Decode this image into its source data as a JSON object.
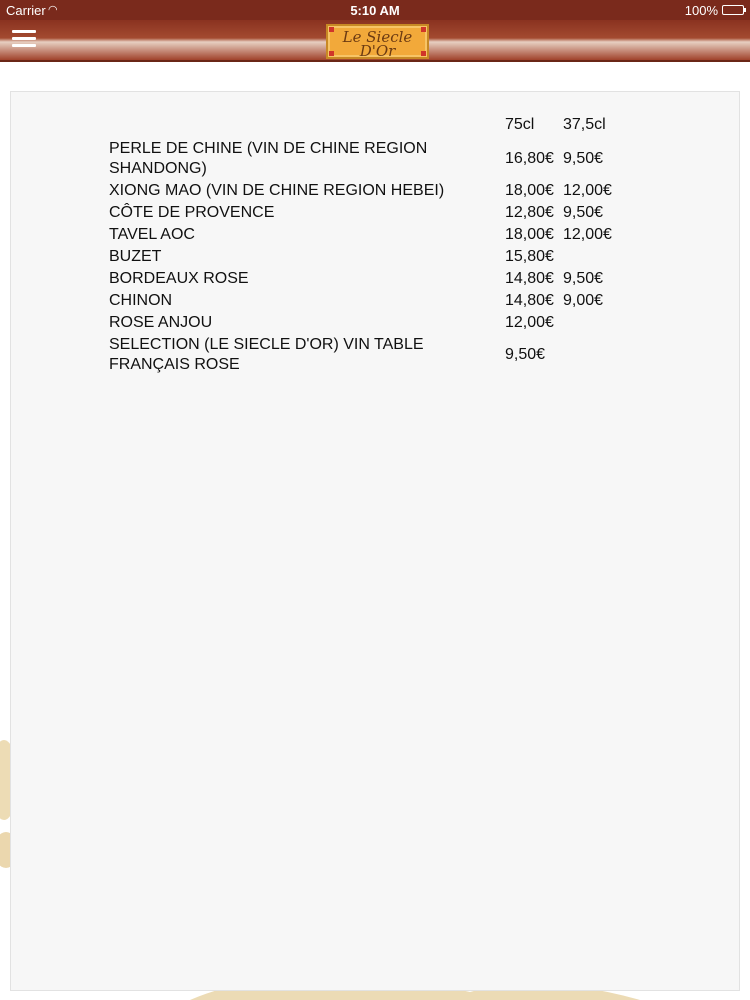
{
  "status_bar": {
    "carrier": "Carrier",
    "wifi_icon": "wifi-icon",
    "time": "5:10 AM",
    "battery": "100%"
  },
  "nav_bar": {
    "menu_icon": "hamburger-menu-icon",
    "logo_line1": "Le Siecle",
    "logo_line2": "D'Or"
  },
  "colors": {
    "status_bar": "#7a2a1c",
    "nav_bar": "#a34a30",
    "logo_background": "#f2a93a",
    "panel": "#f7f7f7"
  },
  "wine_list": {
    "columns": [
      "",
      "75cl",
      "37,5cl"
    ],
    "rows": [
      {
        "name": "PERLE DE CHINE (VIN DE CHINE REGION SHANDONG)",
        "price_75cl": "16,80€",
        "price_37_5cl": "9,50€"
      },
      {
        "name": "XIONG MAO (VIN DE CHINE REGION HEBEI)",
        "price_75cl": "18,00€",
        "price_37_5cl": "12,00€"
      },
      {
        "name": "CÔTE DE PROVENCE",
        "price_75cl": "12,80€",
        "price_37_5cl": "9,50€"
      },
      {
        "name": "TAVEL AOC",
        "price_75cl": "18,00€",
        "price_37_5cl": "12,00€"
      },
      {
        "name": "BUZET",
        "price_75cl": "15,80€",
        "price_37_5cl": ""
      },
      {
        "name": "BORDEAUX ROSE",
        "price_75cl": "14,80€",
        "price_37_5cl": "9,50€"
      },
      {
        "name": "CHINON",
        "price_75cl": "14,80€",
        "price_37_5cl": "9,00€"
      },
      {
        "name": "ROSE ANJOU",
        "price_75cl": "12,00€",
        "price_37_5cl": ""
      },
      {
        "name": "SELECTION (LE SIECLE D'OR) VIN TABLE FRANÇAIS ROSE",
        "price_75cl": "9,50€",
        "price_37_5cl": ""
      }
    ]
  }
}
